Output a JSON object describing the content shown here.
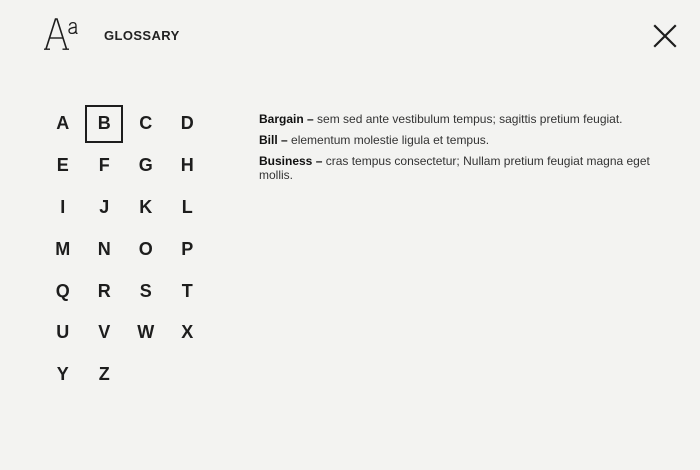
{
  "header": {
    "logo_icon": "font-aa-icon",
    "title": "GLOSSARY",
    "close_icon": "close-x-icon"
  },
  "alphabet": {
    "selected": "B",
    "letters": [
      "A",
      "B",
      "C",
      "D",
      "E",
      "F",
      "G",
      "H",
      "I",
      "J",
      "K",
      "L",
      "M",
      "N",
      "O",
      "P",
      "Q",
      "R",
      "S",
      "T",
      "U",
      "V",
      "W",
      "X",
      "Y",
      "Z"
    ]
  },
  "terms": [
    {
      "name": "Bargain –",
      "definition": " sem sed ante vestibulum tempus; sagittis pretium feugiat."
    },
    {
      "name": "Bill –",
      "definition": " elementum molestie ligula et tempus."
    },
    {
      "name": "Business –",
      "definition": " cras tempus consectetur; Nullam pretium feugiat magna eget mollis."
    }
  ]
}
